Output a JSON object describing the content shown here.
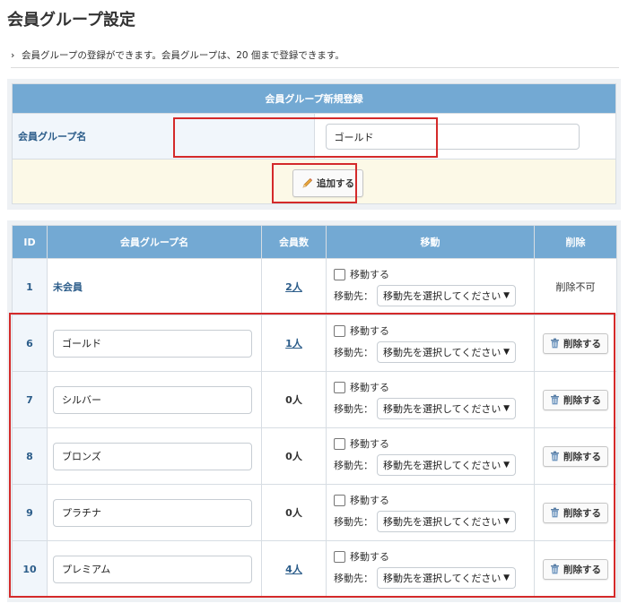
{
  "page_title": "会員グループ設定",
  "notice": "会員グループの登録ができます。会員グループは、20 個まで登録できます。",
  "registration": {
    "header": "会員グループ新規登録",
    "label": "会員グループ名",
    "input_value": "ゴールド",
    "add_button": "追加する"
  },
  "table": {
    "headers": {
      "id": "ID",
      "name": "会員グループ名",
      "count": "会員数",
      "move": "移動",
      "delete": "削除"
    },
    "move_checkbox_label": "移動する",
    "move_dest_label": "移動先：",
    "move_select_placeholder": "移動先を選択してください",
    "delete_button": "削除する",
    "fixed_row": {
      "id": "1",
      "name": "未会員",
      "count": "2人",
      "delete_text": "削除不可"
    },
    "rows": [
      {
        "id": "6",
        "name": "ゴールド",
        "count": "1人"
      },
      {
        "id": "7",
        "name": "シルバー",
        "count": "0人"
      },
      {
        "id": "8",
        "name": "ブロンズ",
        "count": "0人"
      },
      {
        "id": "9",
        "name": "プラチナ",
        "count": "0人"
      },
      {
        "id": "10",
        "name": "プレミアム",
        "count": "4人"
      }
    ]
  },
  "colors": {
    "header_blue": "#73a9d3",
    "label_blue": "#2c5d8a",
    "highlight_red": "#d42a2a",
    "footer_cream": "#fcf9e7"
  },
  "icons": {
    "add_button_icon": "pencil-icon",
    "delete_button_icon": "trash-icon",
    "notice_icon": "chevron-right-icon",
    "select_icon": "chevron-down-icon"
  }
}
